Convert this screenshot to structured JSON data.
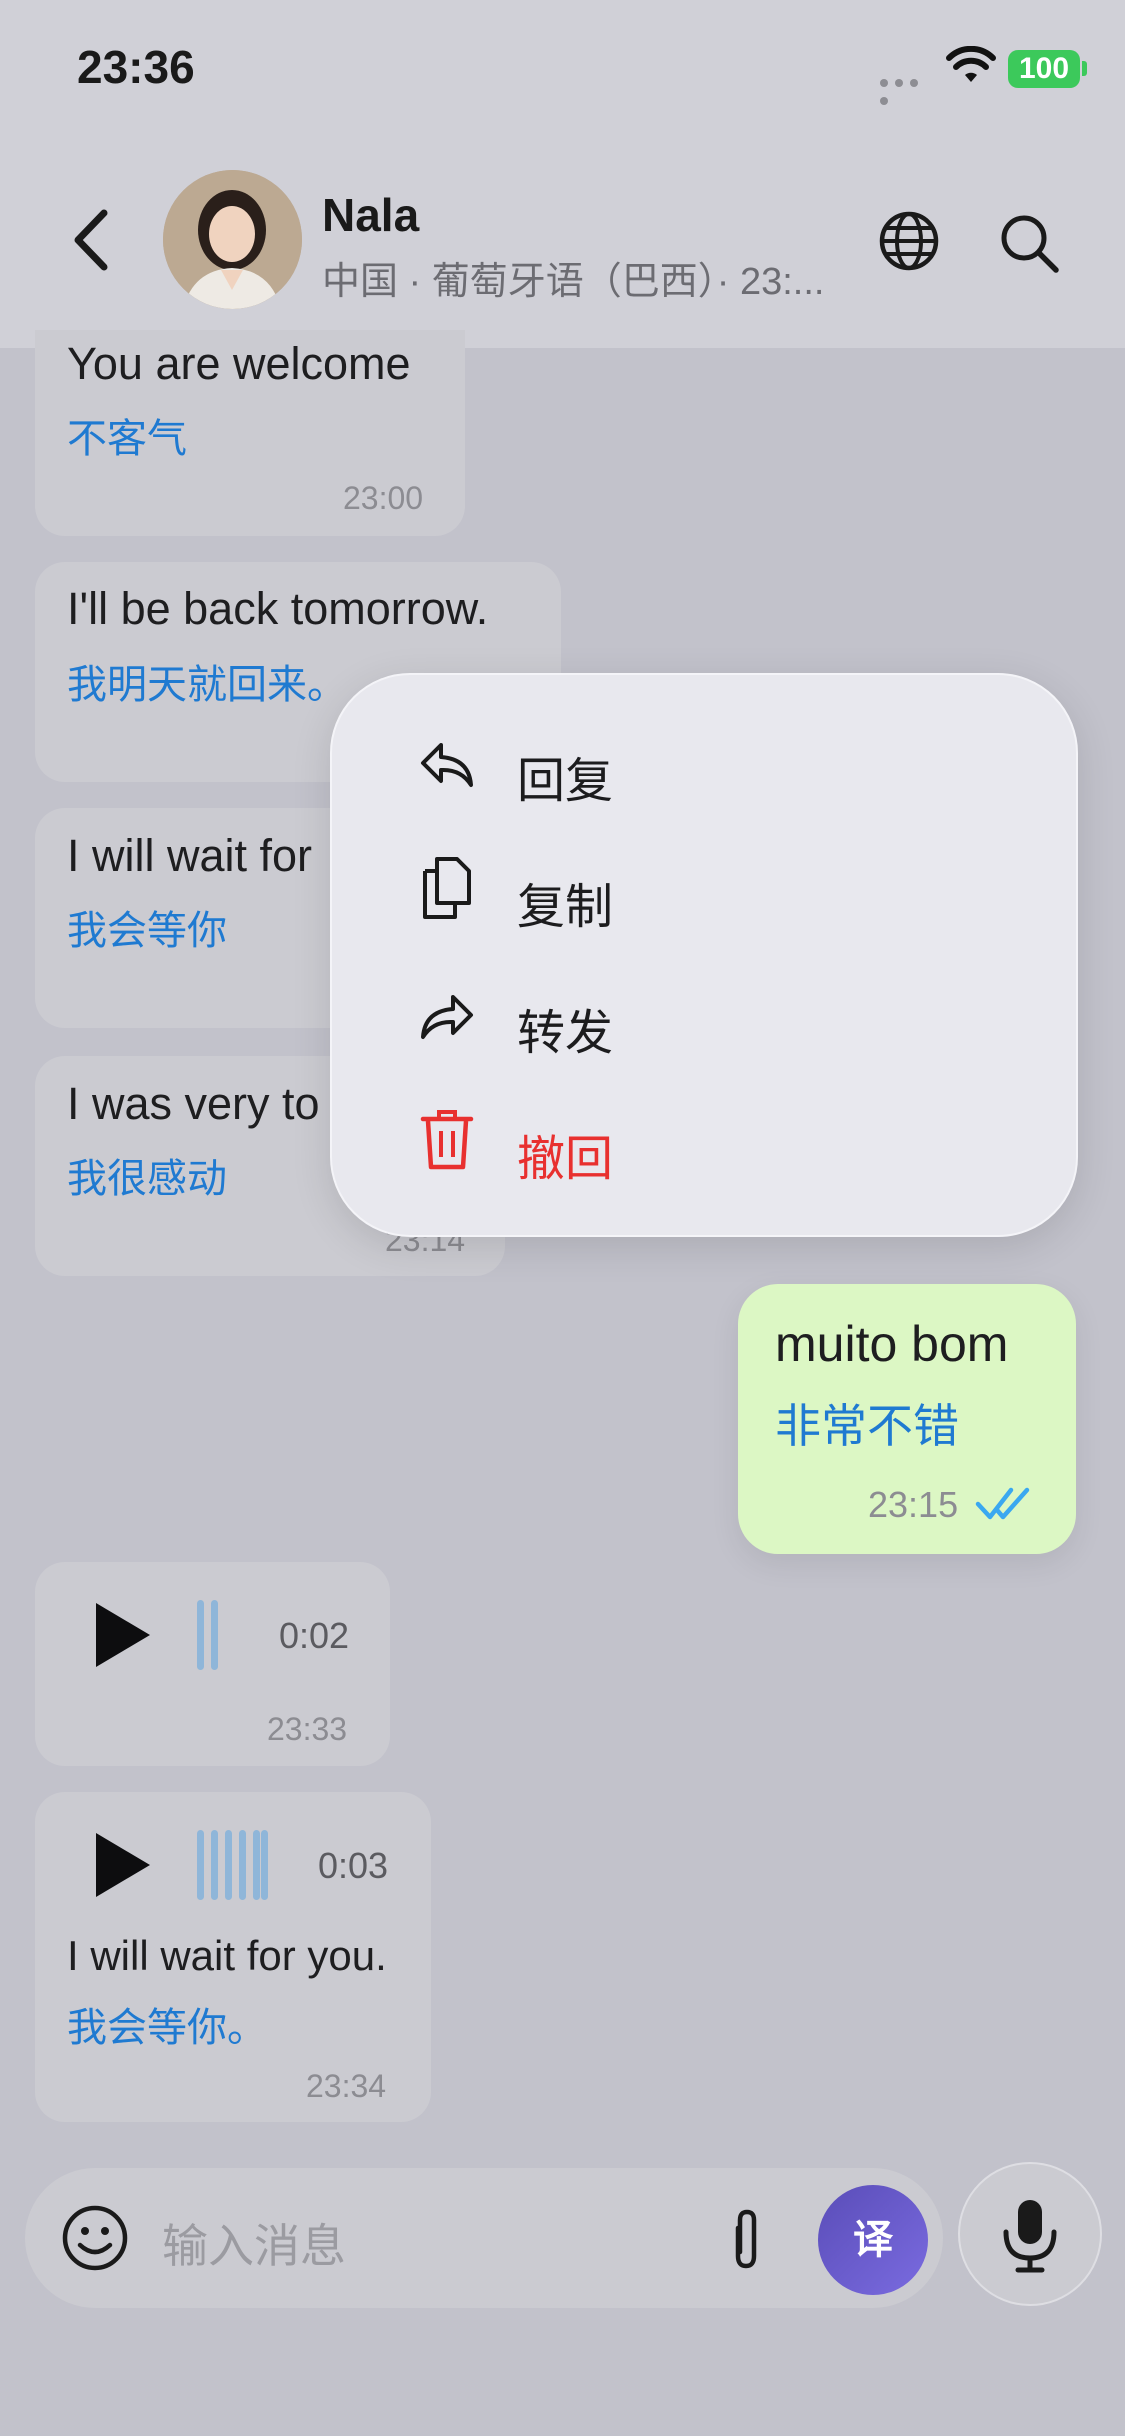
{
  "status_bar": {
    "time": "23:36",
    "battery": "100"
  },
  "header": {
    "contact_name": "Nala",
    "subtitle": "中国 · 葡萄牙语（巴西）· 23:..."
  },
  "messages": [
    {
      "text": "You are welcome",
      "translation": "不客气",
      "time": "23:00"
    },
    {
      "text": "I'll be back tomorrow.",
      "translation": "我明天就回来。"
    },
    {
      "text": "I will wait for",
      "translation": "我会等你"
    },
    {
      "text": "I was very to",
      "translation": "我很感动",
      "time": "23:14"
    },
    {
      "text": "muito bom",
      "translation": "非常不错",
      "time": "23:15"
    }
  ],
  "voice_messages": [
    {
      "duration": "0:02",
      "time": "23:33"
    },
    {
      "duration": "0:03",
      "text": "I will wait for you.",
      "translation": "我会等你。",
      "time": "23:34"
    }
  ],
  "context_menu": {
    "items": [
      {
        "label": "回复",
        "icon": "reply-icon"
      },
      {
        "label": "复制",
        "icon": "copy-icon"
      },
      {
        "label": "转发",
        "icon": "forward-icon"
      },
      {
        "label": "撤回",
        "icon": "trash-icon"
      }
    ]
  },
  "composer": {
    "placeholder": "输入消息",
    "translate_label": "译"
  },
  "colors": {
    "accent_translation": "#1f7ad1",
    "outgoing_bubble": "#dcf7c4",
    "danger": "#e8302f",
    "read_check": "#3aa8f0"
  }
}
